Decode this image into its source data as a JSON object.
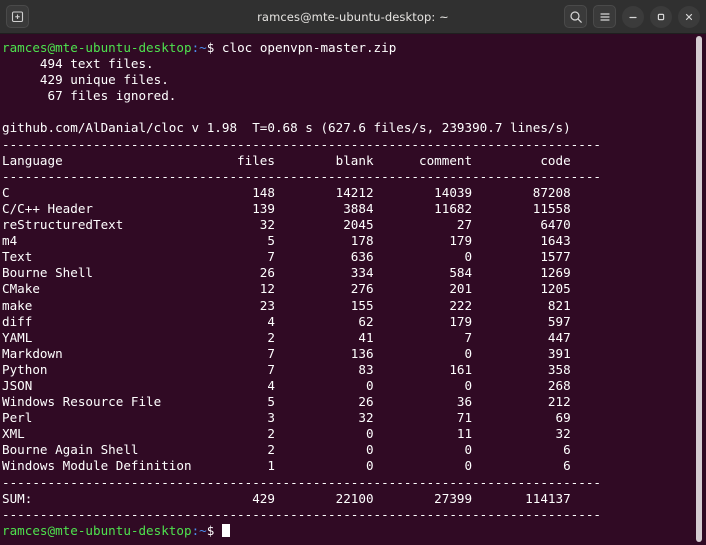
{
  "window": {
    "title": "ramces@mte-ubuntu-desktop: ~",
    "newtab_label": "new-tab",
    "search_label": "search",
    "menu_label": "menu",
    "minimize_label": "minimize",
    "maximize_label": "maximize",
    "close_label": "close",
    "titlebar_bg": "#303030",
    "terminal_bg": "#300a24"
  },
  "terminal": {
    "prompt": {
      "user_host": "ramces@mte-ubuntu-desktop",
      "path": ":~",
      "symbol": "$ ",
      "user_host_color": "#4ee24e",
      "path_color": "#4d8ff0"
    },
    "command": "cloc openvpn-master.zip",
    "preamble": [
      "     494 text files.",
      "     429 unique files.",
      "      67 files ignored."
    ],
    "blank_line": "",
    "version_line": "github.com/AlDanial/cloc v 1.98  T=0.68 s (627.6 files/s, 239390.7 lines/s)",
    "separator": "-------------------------------------------------------------------------------",
    "header": {
      "language": "Language",
      "files": "files",
      "blank": "blank",
      "comment": "comment",
      "code": "code"
    },
    "rows": [
      {
        "language": "C",
        "files": "148",
        "blank": "14212",
        "comment": "14039",
        "code": "87208"
      },
      {
        "language": "C/C++ Header",
        "files": "139",
        "blank": "3884",
        "comment": "11682",
        "code": "11558"
      },
      {
        "language": "reStructuredText",
        "files": "32",
        "blank": "2045",
        "comment": "27",
        "code": "6470"
      },
      {
        "language": "m4",
        "files": "5",
        "blank": "178",
        "comment": "179",
        "code": "1643"
      },
      {
        "language": "Text",
        "files": "7",
        "blank": "636",
        "comment": "0",
        "code": "1577"
      },
      {
        "language": "Bourne Shell",
        "files": "26",
        "blank": "334",
        "comment": "584",
        "code": "1269"
      },
      {
        "language": "CMake",
        "files": "12",
        "blank": "276",
        "comment": "201",
        "code": "1205"
      },
      {
        "language": "make",
        "files": "23",
        "blank": "155",
        "comment": "222",
        "code": "821"
      },
      {
        "language": "diff",
        "files": "4",
        "blank": "62",
        "comment": "179",
        "code": "597"
      },
      {
        "language": "YAML",
        "files": "2",
        "blank": "41",
        "comment": "7",
        "code": "447"
      },
      {
        "language": "Markdown",
        "files": "7",
        "blank": "136",
        "comment": "0",
        "code": "391"
      },
      {
        "language": "Python",
        "files": "7",
        "blank": "83",
        "comment": "161",
        "code": "358"
      },
      {
        "language": "JSON",
        "files": "4",
        "blank": "0",
        "comment": "0",
        "code": "268"
      },
      {
        "language": "Windows Resource File",
        "files": "5",
        "blank": "26",
        "comment": "36",
        "code": "212"
      },
      {
        "language": "Perl",
        "files": "3",
        "blank": "32",
        "comment": "71",
        "code": "69"
      },
      {
        "language": "XML",
        "files": "2",
        "blank": "0",
        "comment": "11",
        "code": "32"
      },
      {
        "language": "Bourne Again Shell",
        "files": "2",
        "blank": "0",
        "comment": "0",
        "code": "6"
      },
      {
        "language": "Windows Module Definition",
        "files": "1",
        "blank": "0",
        "comment": "0",
        "code": "6"
      }
    ],
    "sum": {
      "language": "SUM:",
      "files": "429",
      "blank": "22100",
      "comment": "27399",
      "code": "114137"
    }
  }
}
